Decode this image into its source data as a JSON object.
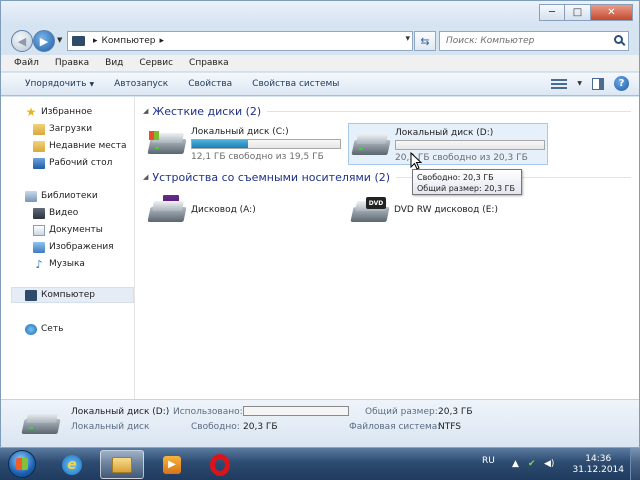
{
  "window": {
    "minimize": "─",
    "maximize": "□",
    "close": "✕"
  },
  "address": {
    "location": "Компьютер",
    "search_placeholder": "Поиск: Компьютер"
  },
  "menu": [
    "Файл",
    "Правка",
    "Вид",
    "Сервис",
    "Справка"
  ],
  "toolbar": {
    "organize": "Упорядочить",
    "autorun": "Автозапуск",
    "properties": "Свойства",
    "system_properties": "Свойства системы",
    "help": "?"
  },
  "sidebar": {
    "favorites": "Избранное",
    "downloads": "Загрузки",
    "recent": "Недавние места",
    "desktop": "Рабочий стол",
    "libraries": "Библиотеки",
    "video": "Видео",
    "documents": "Документы",
    "images": "Изображения",
    "music": "Музыка",
    "computer": "Компьютер",
    "network": "Сеть"
  },
  "groups": {
    "hard_drives": "Жесткие диски (2)",
    "removable": "Устройства со съемными носителями (2)"
  },
  "drives": {
    "c": {
      "name": "Локальный диск (C:)",
      "free": "12,1 ГБ свободно из 19,5 ГБ",
      "used_fraction": 0.38
    },
    "d": {
      "name": "Локальный диск (D:)",
      "free": "20,3 ГБ свободно из 20,3 ГБ",
      "used_fraction": 0.0
    },
    "a": {
      "name": "Дисковод (A:)"
    },
    "e": {
      "name": "DVD RW дисковод (E:)",
      "badge": "DVD"
    }
  },
  "tooltip": {
    "free": "Свободно: 20,3 ГБ",
    "total": "Общий размер: 20,3 ГБ"
  },
  "details": {
    "name": "Локальный диск (D:)",
    "type": "Локальный диск",
    "used_label": "Использовано:",
    "free_label": "Свободно:",
    "free_value": "20,3 ГБ",
    "total_label": "Общий размер:",
    "total_value": "20,3 ГБ",
    "fs_label": "Файловая система:",
    "fs_value": "NTFS"
  },
  "taskbar": {
    "lang": "RU",
    "time": "14:36",
    "date": "31.12.2014"
  },
  "colors": {
    "bar_fill": "#1c7fb8",
    "group_title": "#1e3287"
  }
}
